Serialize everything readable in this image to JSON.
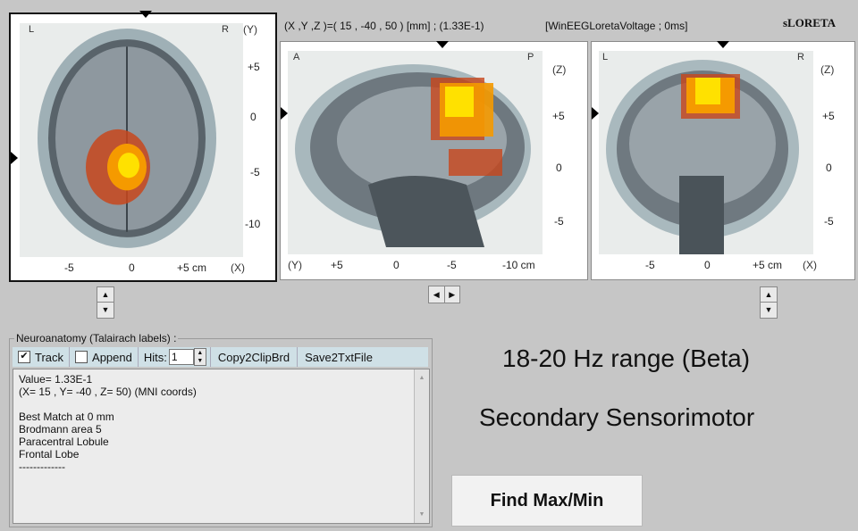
{
  "header": {
    "coords": "(X ,Y ,Z )=( 15 , -40 , 50 ) [mm] ;  (1.33E-1)",
    "source": "[WinEEGLoretaVoltage ; 0ms]",
    "brand": "sLORETA"
  },
  "views": {
    "axial": {
      "corner_left": "L",
      "corner_right": "R",
      "axis_v": "(Y)",
      "axis_h": "(X)",
      "ticks_v": [
        "+5",
        "0",
        "-5",
        "-10"
      ],
      "ticks_h": [
        "-5",
        "0",
        "+5 cm"
      ]
    },
    "sagittal": {
      "corner_left": "A",
      "corner_right": "P",
      "axis_v": "(Z)",
      "axis_h": "(Y)",
      "ticks_v": [
        "+5",
        "0",
        "-5"
      ],
      "ticks_h": [
        "+5",
        "0",
        "-5",
        "-10 cm"
      ]
    },
    "coronal": {
      "corner_left": "L",
      "corner_right": "R",
      "axis_v": "(Z)",
      "axis_h": "(X)",
      "ticks_v": [
        "+5",
        "0",
        "-5"
      ],
      "ticks_h": [
        "-5",
        "0",
        "+5 cm"
      ]
    }
  },
  "spinners": {
    "up": "▲",
    "down": "▼",
    "left": "◀",
    "right": "▶"
  },
  "neuro": {
    "group_label": "Neuroanatomy (Talairach labels) :",
    "track_label": "Track",
    "track_checked": true,
    "append_label": "Append",
    "append_checked": false,
    "hits_label": "Hits:",
    "hits_value": "1",
    "copy_label": "Copy2ClipBrd",
    "save_label": "Save2TxtFile",
    "lines": [
      "Value= 1.33E-1",
      "(X= 15 , Y= -40 , Z= 50) (MNI coords)",
      "",
      "Best Match at 0 mm",
      "Brodmann area 5",
      "Paracentral Lobule",
      "Frontal Lobe",
      "-------------"
    ]
  },
  "right_panel": {
    "line1": "18-20 Hz range (Beta)",
    "line2": "Secondary Sensorimotor",
    "find_button": "Find Max/Min"
  },
  "colors": {
    "hot_core": "#ffe100",
    "hot_mid": "#f59a00",
    "hot_outer": "#c8461c"
  }
}
